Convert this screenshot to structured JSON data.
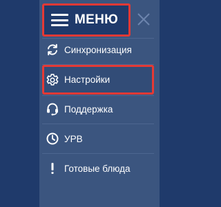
{
  "menu": {
    "title": "МЕНЮ",
    "items": [
      {
        "label": "Синхронизация",
        "icon": "sync-icon"
      },
      {
        "label": "Настройки",
        "icon": "gear-icon"
      },
      {
        "label": "Поддержка",
        "icon": "headset-icon"
      },
      {
        "label": "УРВ",
        "icon": "clock-icon"
      },
      {
        "label": "Готовые блюда",
        "icon": "exclamation-icon"
      }
    ]
  },
  "colors": {
    "background": "#1f3a6b",
    "panel": "#3b557f",
    "highlight_border": "#e53935",
    "text": "#ffffff"
  }
}
